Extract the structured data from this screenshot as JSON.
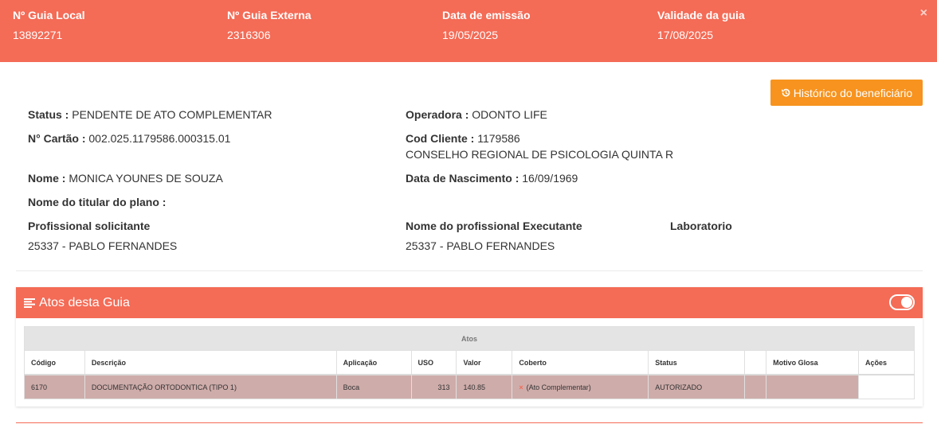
{
  "header": {
    "guia_local": {
      "label": "Nº Guia Local",
      "value": "13892271"
    },
    "guia_externa": {
      "label": "Nº Guia Externa",
      "value": "2316306"
    },
    "data_emissao": {
      "label": "Data de emissão",
      "value": "19/05/2025"
    },
    "validade": {
      "label": "Validade da guia",
      "value": "17/08/2025"
    },
    "close_label": "×"
  },
  "historico_button": {
    "label": "Histórico do beneficiário",
    "icon": "history-icon"
  },
  "info": {
    "status": {
      "label": "Status :",
      "value": "PENDENTE DE ATO COMPLEMENTAR"
    },
    "operadora": {
      "label": "Operadora :",
      "value": "ODONTO LIFE"
    },
    "cartao": {
      "label": "N° Cartão :",
      "value": "002.025.1179586.000315.01"
    },
    "cod_cliente": {
      "label": "Cod Cliente :",
      "value": "1179586",
      "extra": "CONSELHO REGIONAL DE PSICOLOGIA QUINTA R"
    },
    "nome": {
      "label": "Nome :",
      "value": "MONICA YOUNES DE SOUZA"
    },
    "nascimento": {
      "label": "Data de Nascimento :",
      "value": "16/09/1969"
    },
    "titular": {
      "label": "Nome do titular do plano :",
      "value": ""
    },
    "solicitante": {
      "label": "Profissional solicitante",
      "value": "25337 - PABLO FERNANDES"
    },
    "executante": {
      "label": "Nome do profissional Executante",
      "value": "25337 - PABLO FERNANDES"
    },
    "laboratorio": {
      "label": "Laboratorio",
      "value": ""
    }
  },
  "atos_panel": {
    "title": "Atos desta Guia",
    "icon": "list-icon",
    "toggle_on": true,
    "table": {
      "group_header": "Atos",
      "columns": [
        "Código",
        "Descrição",
        "Aplicação",
        "USO",
        "Valor",
        "Coberto",
        "Status",
        "",
        "Motivo Glosa",
        "Ações"
      ],
      "rows": [
        {
          "codigo": "6170",
          "descricao": "DOCUMENTAÇÃO ORTODONTICA (TIPO 1)",
          "aplicacao": "Boca",
          "uso": "313",
          "valor": "140.85",
          "coberto_mark": "×",
          "coberto": "(Ato Complementar)",
          "status": "AUTORIZADO",
          "blank": "",
          "motivo_glosa": "",
          "acoes": ""
        }
      ]
    }
  },
  "colors": {
    "header_bg": "#f46b56",
    "button_bg": "#f7931e",
    "row_bg": "#ceacaa"
  }
}
